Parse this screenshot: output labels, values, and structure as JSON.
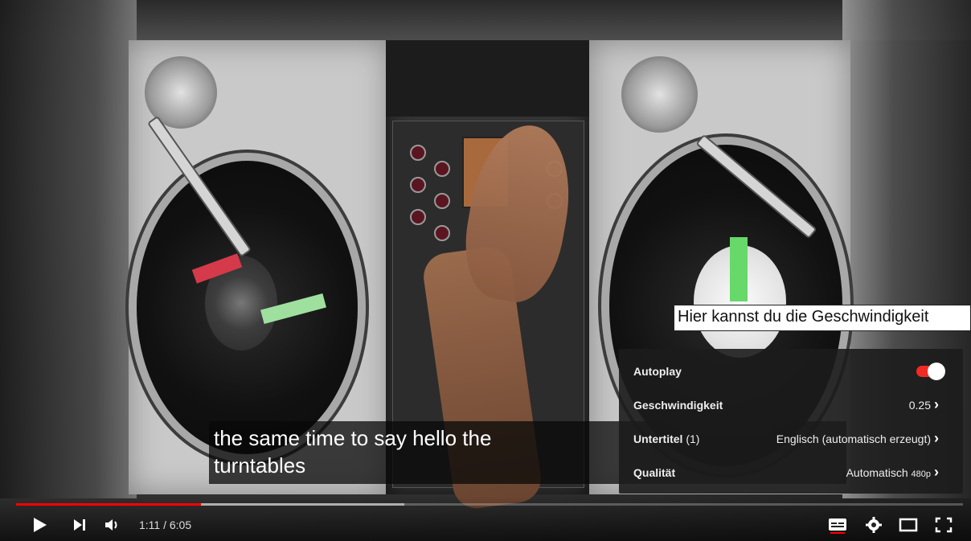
{
  "video": {
    "captions": [
      "the same time to say hello the",
      "turntables"
    ],
    "tooltip": "Hier kannst du die Geschwindigkeit"
  },
  "settings_menu": {
    "autoplay": {
      "label": "Autoplay",
      "enabled": true
    },
    "speed": {
      "label": "Geschwindigkeit",
      "value": "0.25"
    },
    "subtitles": {
      "label": "Untertitel",
      "count": "(1)",
      "value": "Englisch (automatisch erzeugt)"
    },
    "quality": {
      "label": "Qualität",
      "value": "Automatisch",
      "resolution": "480p"
    }
  },
  "player": {
    "current_time": "1:11",
    "duration": "6:05",
    "time_display": "1:11 / 6:05",
    "played_fraction": 0.195,
    "buffered_fraction": 0.41,
    "accent_color": "#ff0000",
    "icons": [
      "play-icon",
      "next-icon",
      "volume-icon",
      "subtitles-icon",
      "settings-icon",
      "theater-mode-icon",
      "fullscreen-icon"
    ]
  }
}
